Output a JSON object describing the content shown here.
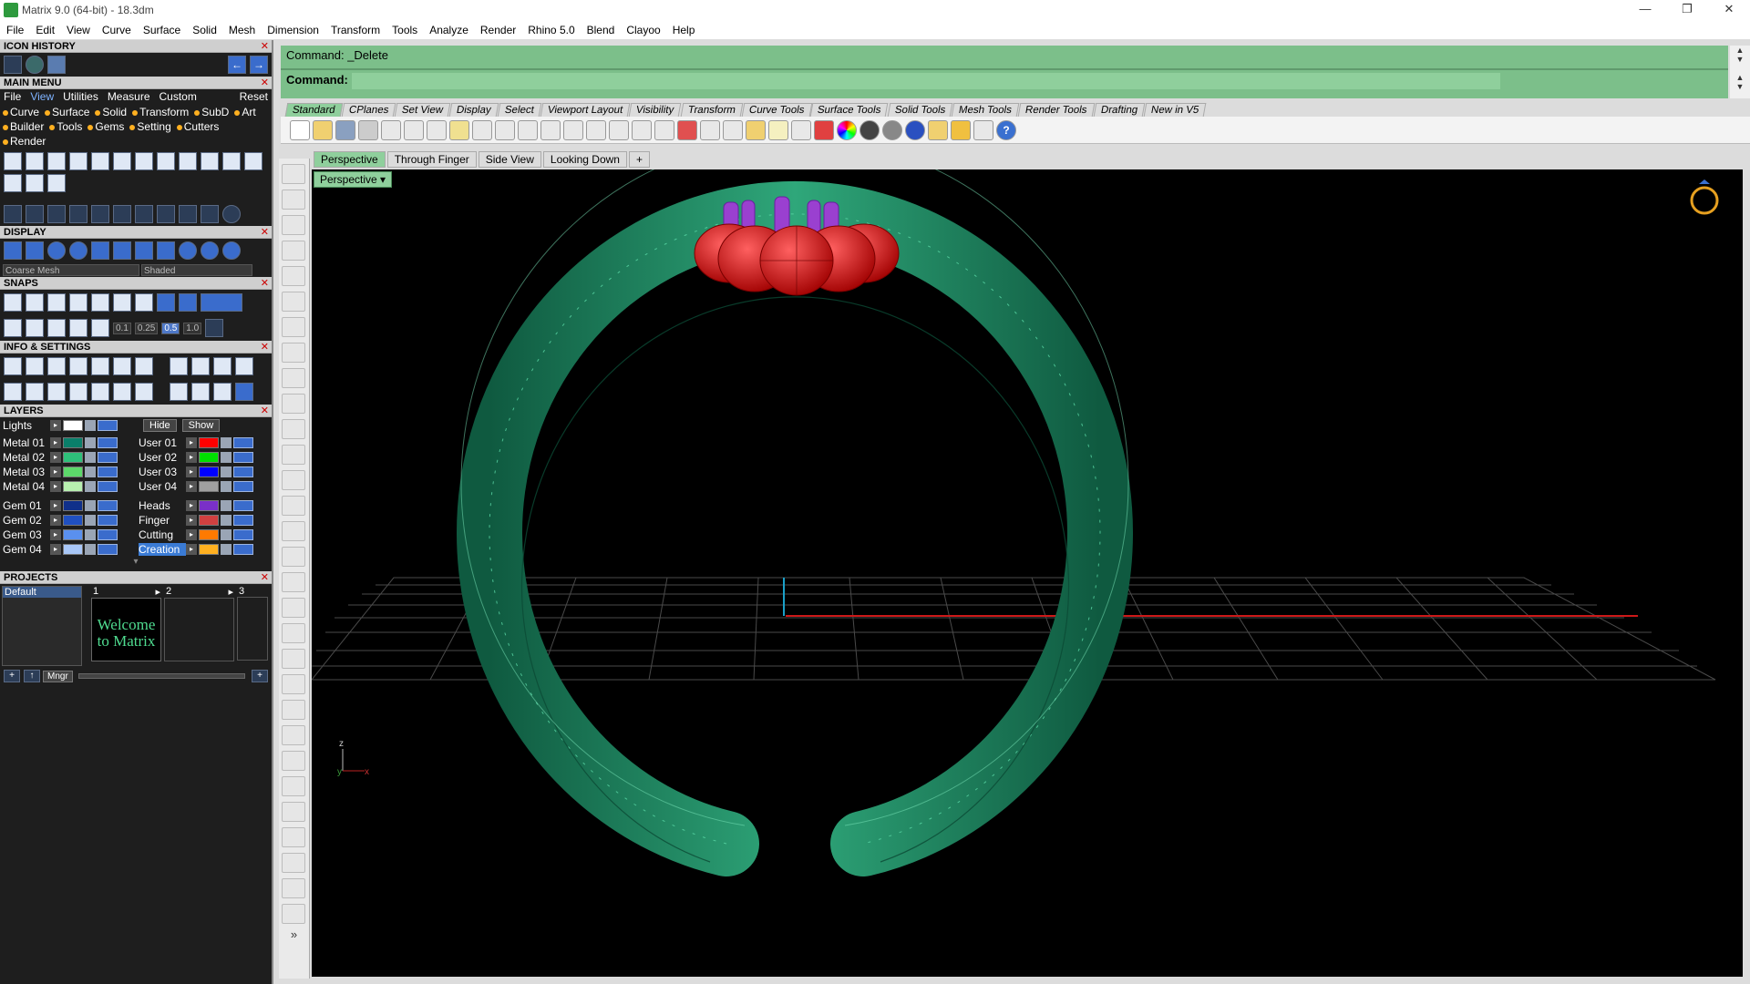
{
  "window": {
    "title": "Matrix 9.0 (64-bit) - 18.3dm",
    "controls": [
      "—",
      "❐",
      "✕"
    ]
  },
  "menubar": [
    "File",
    "Edit",
    "View",
    "Curve",
    "Surface",
    "Solid",
    "Mesh",
    "Dimension",
    "Transform",
    "Tools",
    "Analyze",
    "Render",
    "Rhino 5.0",
    "Blend",
    "Clayoo",
    "Help"
  ],
  "panels": {
    "icon_history": "ICON HISTORY",
    "main_menu": {
      "title": "MAIN MENU",
      "tabs": [
        "File",
        "View",
        "Utilities",
        "Measure",
        "Custom"
      ],
      "active_tab": "View",
      "reset": "Reset",
      "row1": [
        "Curve",
        "Surface",
        "Solid",
        "Transform",
        "SubD",
        "Art"
      ],
      "row2": [
        "Builder",
        "Tools",
        "Gems",
        "Setting",
        "Cutters",
        "Render"
      ]
    },
    "display": {
      "title": "DISPLAY",
      "mesh_combo": "Coarse Mesh",
      "mode_combo": "Shaded"
    },
    "snaps": {
      "title": "SNAPS",
      "values": [
        "0.1",
        "0.25",
        "0.5",
        "1.0"
      ],
      "active_value": "0.5"
    },
    "info": "INFO & SETTINGS",
    "layers": {
      "title": "LAYERS",
      "lights": "Lights",
      "hide": "Hide",
      "show": "Show",
      "left": [
        {
          "name": "Metal 01",
          "color": "#0a7f6a"
        },
        {
          "name": "Metal 02",
          "color": "#2ec07a"
        },
        {
          "name": "Metal 03",
          "color": "#5cd86a"
        },
        {
          "name": "Metal 04",
          "color": "#b8f0b0"
        },
        {
          "name": "Gem 01",
          "color": "#10308a"
        },
        {
          "name": "Gem 02",
          "color": "#2050c0"
        },
        {
          "name": "Gem 03",
          "color": "#5a90ee"
        },
        {
          "name": "Gem 04",
          "color": "#a9c7f7"
        }
      ],
      "right": [
        {
          "name": "User 01",
          "color": "#ff0000"
        },
        {
          "name": "User 02",
          "color": "#00e000"
        },
        {
          "name": "User 03",
          "color": "#0000ff"
        },
        {
          "name": "User 04",
          "color": "#a0a0a0"
        },
        {
          "name": "Heads",
          "color": "#7a30c8"
        },
        {
          "name": "Finger",
          "color": "#d04040"
        },
        {
          "name": "Cutting",
          "color": "#ff7a00"
        },
        {
          "name": "Creation",
          "color": "#ffb020",
          "selected": true
        }
      ]
    },
    "projects": {
      "title": "PROJECTS",
      "default_label": "Default",
      "slots": [
        "1",
        "2",
        "3"
      ],
      "thumb_text": "Welcome to Matrix",
      "mngr": "Mngr"
    }
  },
  "command": {
    "history": "Command: _Delete",
    "prompt": "Command:"
  },
  "toolbar_tabs": [
    "Standard",
    "CPlanes",
    "Set View",
    "Display",
    "Select",
    "Viewport Layout",
    "Visibility",
    "Transform",
    "Curve Tools",
    "Surface Tools",
    "Solid Tools",
    "Mesh Tools",
    "Render Tools",
    "Drafting",
    "New in V5"
  ],
  "active_toolbar_tab": "Standard",
  "viewport_tabs": [
    "Perspective",
    "Through Finger",
    "Side View",
    "Looking Down"
  ],
  "viewport_add": "+",
  "viewport_label": "Perspective",
  "axis": {
    "z": "z",
    "y": "y",
    "x": "x"
  },
  "colors": {
    "ring": "#1e8a62",
    "gem": "#e01818",
    "prong": "#9a40d0",
    "panel_accent": "#8fcf9c"
  }
}
